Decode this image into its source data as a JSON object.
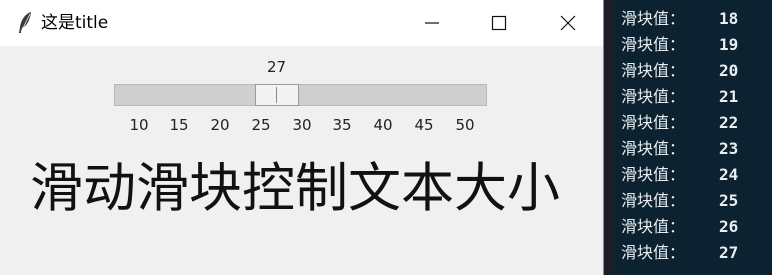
{
  "window": {
    "title": "这是title",
    "icons": {
      "app": "feather-icon",
      "minimize": "minimize-icon",
      "maximize": "maximize-icon",
      "close": "close-icon"
    }
  },
  "scale": {
    "value": "27",
    "value_number": 27,
    "min": 10,
    "max": 50,
    "ticks": [
      "10",
      "15",
      "20",
      "25",
      "30",
      "35",
      "40",
      "45",
      "50"
    ]
  },
  "label": {
    "text": "滑动滑块控制文本大小"
  },
  "console": {
    "lines": [
      {
        "label": "滑块值：",
        "value": "18"
      },
      {
        "label": "滑块值：",
        "value": "19"
      },
      {
        "label": "滑块值：",
        "value": "20"
      },
      {
        "label": "滑块值：",
        "value": "21"
      },
      {
        "label": "滑块值：",
        "value": "22"
      },
      {
        "label": "滑块值：",
        "value": "23"
      },
      {
        "label": "滑块值：",
        "value": "24"
      },
      {
        "label": "滑块值：",
        "value": "25"
      },
      {
        "label": "滑块值：",
        "value": "26"
      },
      {
        "label": "滑块值：",
        "value": "27"
      }
    ]
  },
  "colors": {
    "window_bg": "#f0f0f0",
    "console_bg": "#0c2230",
    "console_text": "#e9eef2"
  }
}
